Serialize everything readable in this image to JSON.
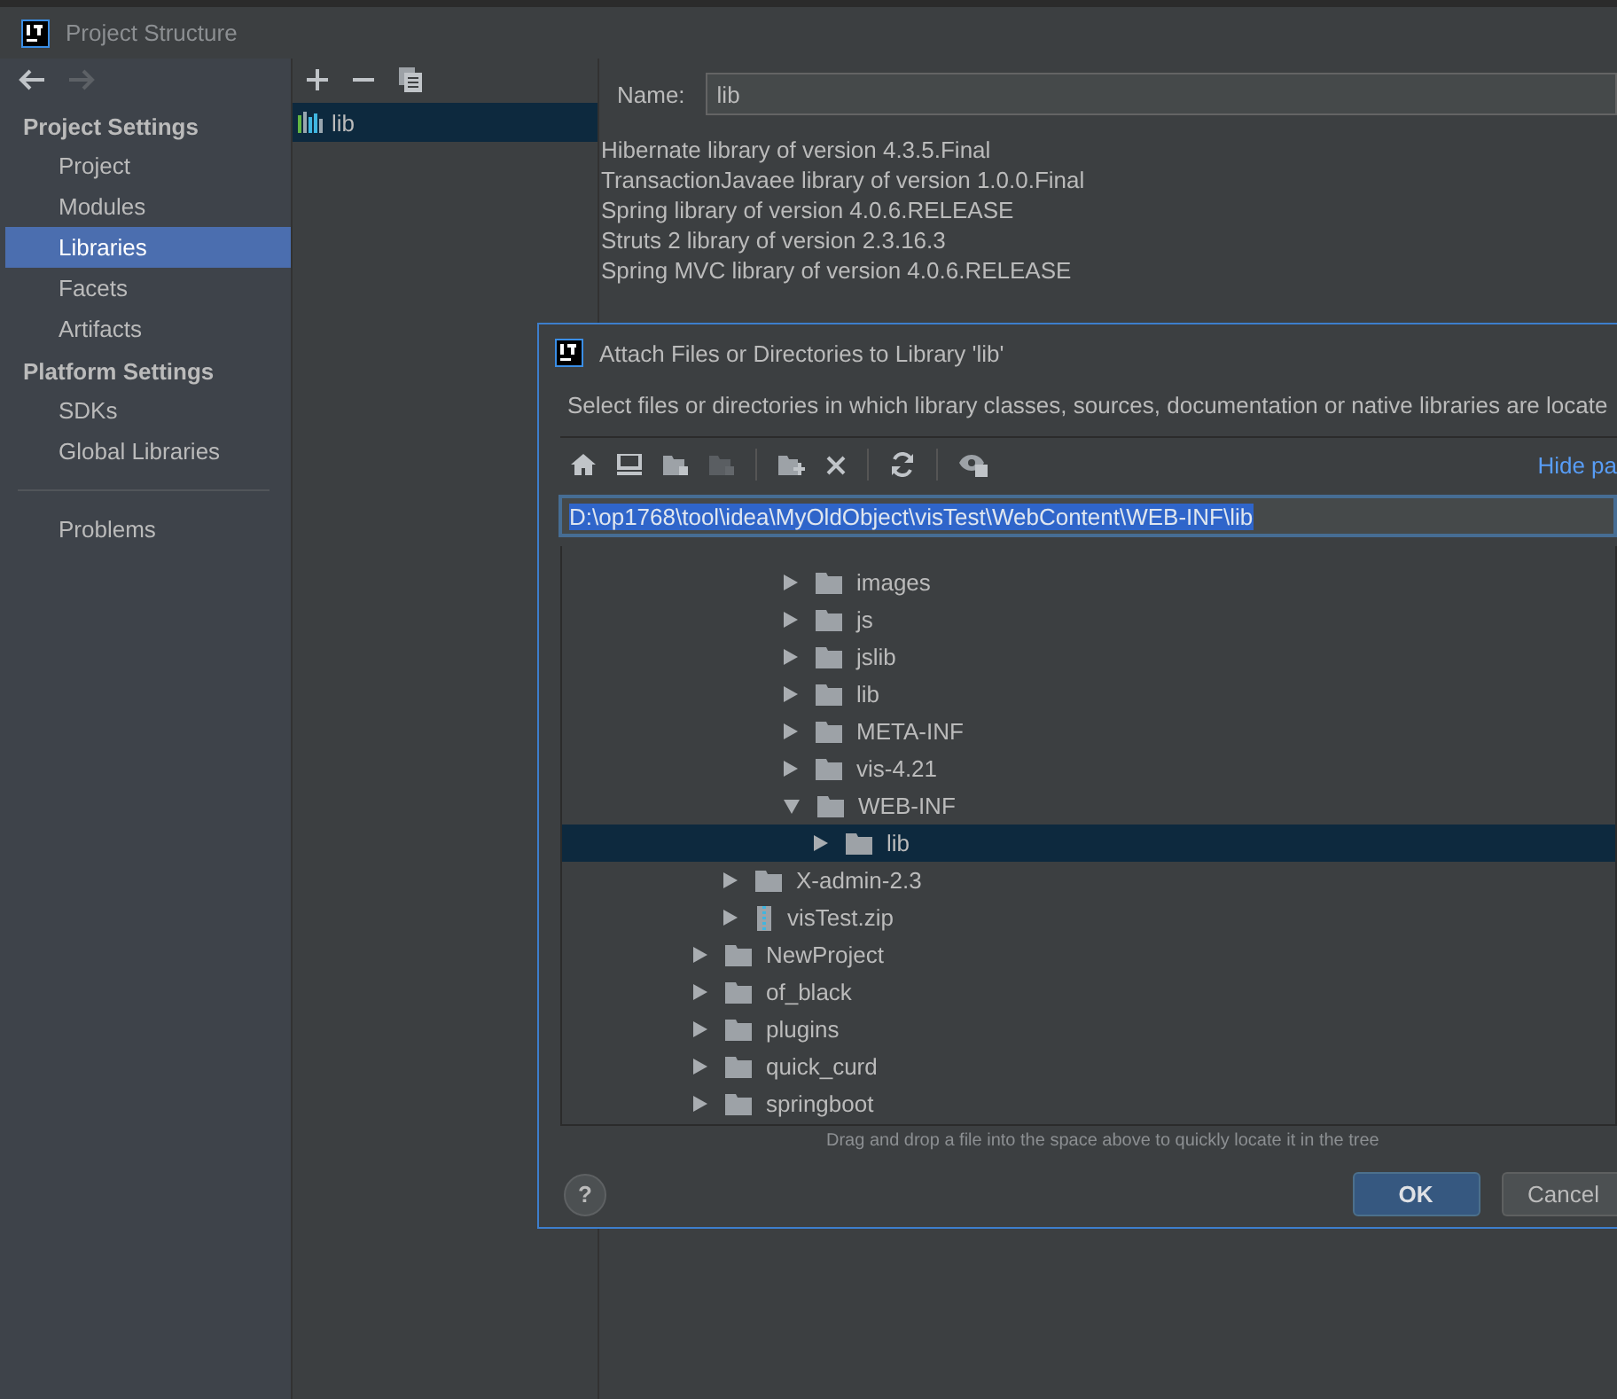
{
  "window": {
    "title": "Project Structure"
  },
  "nav": {
    "back_enabled": true,
    "forward_enabled": false
  },
  "sidebar": {
    "sections": [
      {
        "title": "Project Settings",
        "items": [
          {
            "label": "Project",
            "selected": false
          },
          {
            "label": "Modules",
            "selected": false
          },
          {
            "label": "Libraries",
            "selected": true
          },
          {
            "label": "Facets",
            "selected": false
          },
          {
            "label": "Artifacts",
            "selected": false
          }
        ]
      },
      {
        "title": "Platform Settings",
        "items": [
          {
            "label": "SDKs",
            "selected": false
          },
          {
            "label": "Global Libraries",
            "selected": false
          }
        ]
      }
    ],
    "footer_items": [
      {
        "label": "Problems",
        "selected": false
      }
    ]
  },
  "libraries": {
    "items": [
      {
        "label": "lib",
        "selected": true
      }
    ]
  },
  "details": {
    "name_label": "Name:",
    "name_value": "lib",
    "descriptions": [
      "Hibernate library of version 4.3.5.Final",
      "TransactionJavaee library of version 1.0.0.Final",
      "Spring library of version 4.0.6.RELEASE",
      "Struts 2 library of version 2.3.16.3",
      "Spring MVC library of version 4.0.6.RELEASE"
    ]
  },
  "dialog": {
    "title": "Attach Files or Directories to Library 'lib'",
    "description": "Select files or directories in which library classes, sources, documentation or native libraries are locate",
    "hide_link": "Hide pa",
    "path": "D:\\op1768\\tool\\idea\\MyOldObject\\visTest\\WebContent\\WEB-INF\\lib",
    "tree": {
      "items": [
        {
          "children": [
            {
              "children": [
                {
                  "children": [
                    {
                      "label": "images",
                      "kind": "folder",
                      "expanded": false,
                      "selected": false
                    },
                    {
                      "label": "js",
                      "kind": "folder",
                      "expanded": false,
                      "selected": false
                    },
                    {
                      "label": "jslib",
                      "kind": "folder",
                      "expanded": false,
                      "selected": false
                    },
                    {
                      "label": "lib",
                      "kind": "folder",
                      "expanded": false,
                      "selected": false
                    },
                    {
                      "label": "META-INF",
                      "kind": "folder",
                      "expanded": false,
                      "selected": false
                    },
                    {
                      "label": "vis-4.21",
                      "kind": "folder",
                      "expanded": false,
                      "selected": false
                    },
                    {
                      "label": "WEB-INF",
                      "kind": "folder",
                      "expanded": true,
                      "selected": false,
                      "children": [
                        {
                          "label": "lib",
                          "kind": "folder",
                          "expanded": false,
                          "selected": true
                        }
                      ]
                    }
                  ]
                }
              ]
            },
            {
              "label": "X-admin-2.3",
              "kind": "folder",
              "expanded": false,
              "selected": false
            },
            {
              "label": "visTest.zip",
              "kind": "archive",
              "expanded": false,
              "selected": false
            }
          ]
        },
        {
          "label": "NewProject",
          "kind": "folder",
          "expanded": false,
          "selected": false
        },
        {
          "label": "of_black",
          "kind": "folder",
          "expanded": false,
          "selected": false
        },
        {
          "label": "plugins",
          "kind": "folder",
          "expanded": false,
          "selected": false
        },
        {
          "label": "quick_curd",
          "kind": "folder",
          "expanded": false,
          "selected": false
        },
        {
          "label": "springboot",
          "kind": "folder",
          "expanded": false,
          "selected": false
        }
      ]
    },
    "hint": "Drag and drop a file into the space above to quickly locate it in the tree",
    "help": "?",
    "buttons": [
      {
        "label": "OK",
        "kind": "default"
      },
      {
        "label": "Cancel",
        "kind": "normal"
      }
    ]
  }
}
